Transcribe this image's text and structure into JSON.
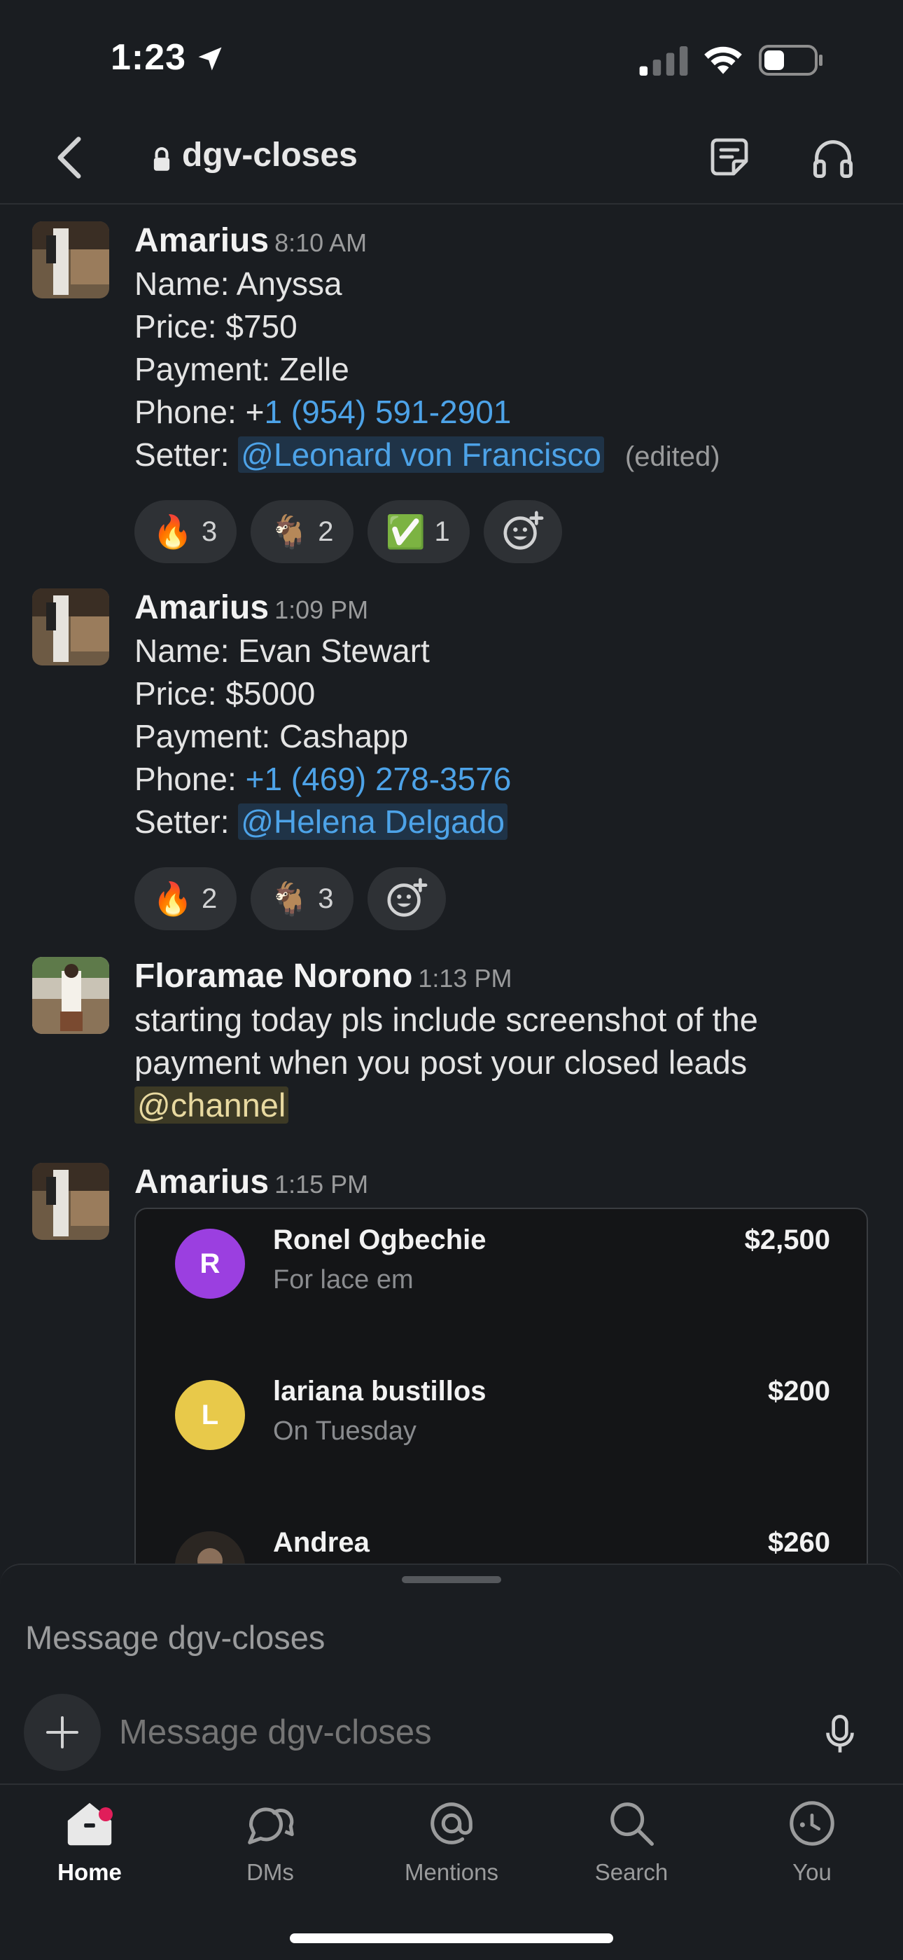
{
  "status_bar": {
    "time": "1:23"
  },
  "header": {
    "channel": "dgv-closes"
  },
  "messages": [
    {
      "author": "Amarius",
      "time": "8:10 AM",
      "lines": {
        "name": "Name: Anyssa",
        "price": "Price: $750",
        "payment": "Payment: Zelle",
        "phone_label": "Phone: +",
        "phone": "1 (954) 591-2901",
        "setter_label": "Setter: ",
        "setter": "@Leonard von Francisco",
        "edited": "(edited)"
      },
      "reactions": [
        {
          "emoji": "🔥",
          "count": "3"
        },
        {
          "emoji": "🐐",
          "count": "2"
        },
        {
          "emoji": "✅",
          "count": "1"
        }
      ]
    },
    {
      "author": "Amarius",
      "time": "1:09 PM",
      "lines": {
        "name": "Name: Evan Stewart",
        "price": "Price: $5000",
        "payment": "Payment: Cashapp",
        "phone_label": "Phone: ",
        "phone": "+1 (469) 278-3576",
        "setter_label": "Setter: ",
        "setter": "@Helena Delgado"
      },
      "reactions": [
        {
          "emoji": "🔥",
          "count": "2"
        },
        {
          "emoji": "🐐",
          "count": "3"
        }
      ]
    },
    {
      "author": "Floramae Norono",
      "time": "1:13 PM",
      "text_line1": "starting today pls include screenshot of the",
      "text_line2": "payment when you post your closed leads",
      "mention": "@channel"
    },
    {
      "author": "Amarius",
      "time": "1:15 PM",
      "payments": [
        {
          "initial": "R",
          "color": "#9b3fe0",
          "name": "Ronel Ogbechie",
          "note": "For lace em",
          "amount": "$2,500"
        },
        {
          "initial": "L",
          "color": "#e8c94a",
          "name": "lariana bustillos",
          "note": "On Tuesday",
          "amount": "$200"
        },
        {
          "initial": "",
          "color": "#2a2a2a",
          "name": "Andrea",
          "note": "",
          "amount": "$260"
        }
      ]
    }
  ],
  "composer": {
    "draft": "Message dgv-closes",
    "placeholder": "Message dgv-closes"
  },
  "tabs": [
    {
      "label": "Home",
      "icon": "home-icon",
      "active": true
    },
    {
      "label": "DMs",
      "icon": "dms-icon"
    },
    {
      "label": "Mentions",
      "icon": "mentions-icon"
    },
    {
      "label": "Search",
      "icon": "search-icon"
    },
    {
      "label": "You",
      "icon": "you-icon"
    }
  ],
  "colors": {
    "background": "#1a1d21",
    "link": "#4da3e8",
    "badge": "#e01e5a"
  }
}
